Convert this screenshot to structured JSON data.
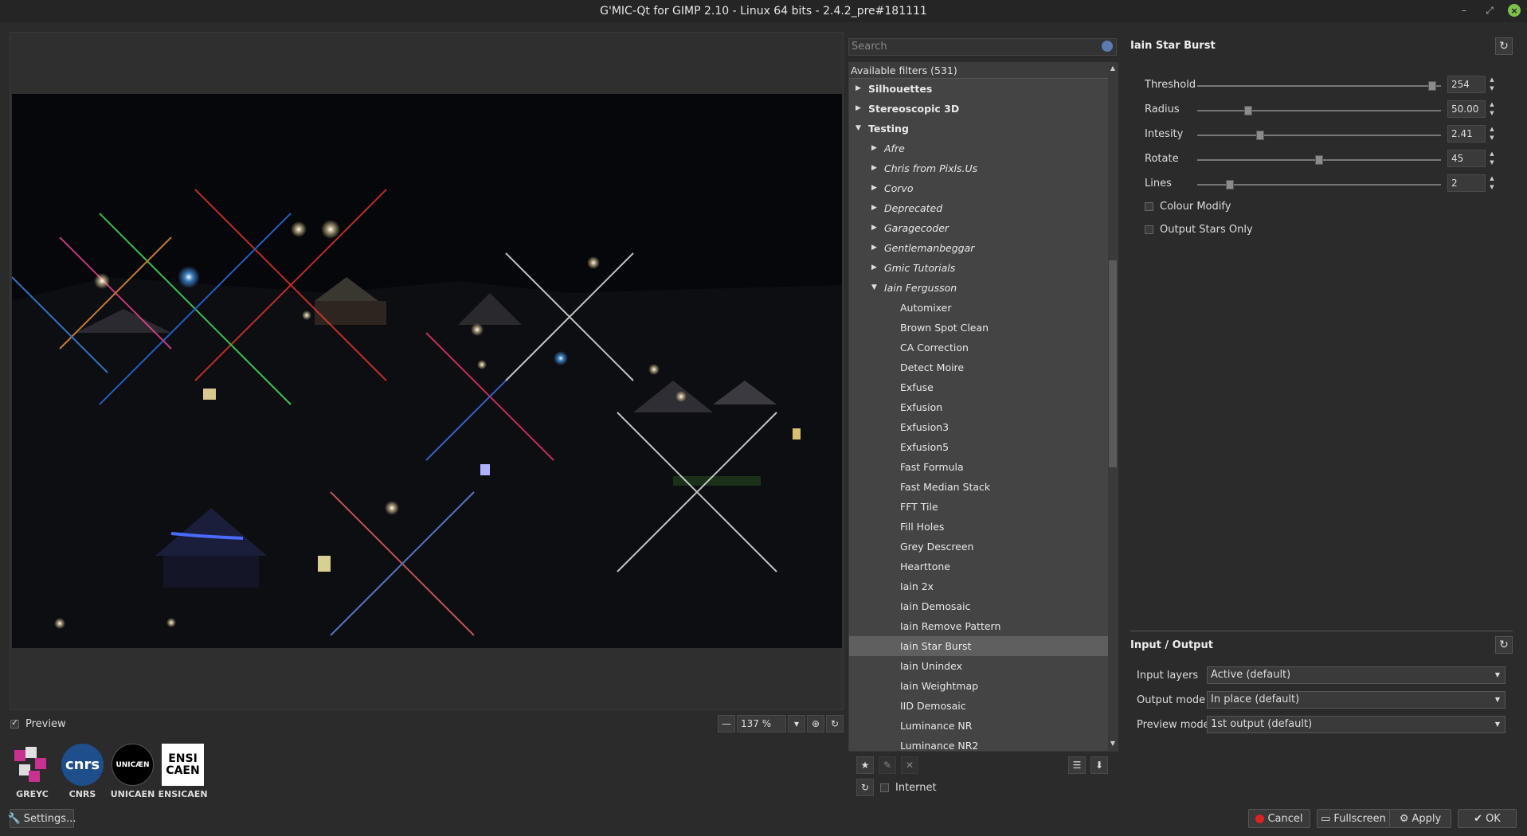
{
  "window": {
    "title": "G'MIC-Qt for GIMP 2.10 - Linux 64 bits - 2.4.2_pre#181111"
  },
  "preview": {
    "label": "Preview",
    "zoom": "137 %"
  },
  "logos": [
    "GREYC",
    "CNRS",
    "UNICAEN",
    "ENSICAEN"
  ],
  "logo_marks": {
    "cnrs": "cnrs",
    "unicaen": "UNICÆN",
    "ensicaen_1": "ENSI",
    "ensicaen_2": "CAEN"
  },
  "buttons": {
    "settings": "Settings...",
    "cancel": "Cancel",
    "fullscreen": "Fullscreen",
    "apply": "Apply",
    "ok": "OK"
  },
  "search": {
    "placeholder": "Search"
  },
  "tree": {
    "header": "Available filters (531)",
    "categories": [
      "Silhouettes",
      "Stereoscopic 3D",
      "Testing"
    ],
    "subcategories": [
      "Afre",
      "Chris from Pixls.Us",
      "Corvo",
      "Deprecated",
      "Garagecoder",
      "Gentlemanbeggar",
      "Gmic Tutorials",
      "Iain Fergusson"
    ],
    "filters": [
      "Automixer",
      "Brown Spot Clean",
      "CA Correction",
      "Detect Moire",
      "Exfuse",
      "Exfusion",
      "Exfusion3",
      "Exfusion5",
      "Fast Formula",
      "Fast Median Stack",
      "FFT Tile",
      "Fill Holes",
      "Grey Descreen",
      "Hearttone",
      "Iain 2x",
      "Iain Demosaic",
      "Iain Remove Pattern",
      "Iain Star Burst",
      "Iain Unindex",
      "Iain Weightmap",
      "IID Demosaic",
      "Luminance NR",
      "Luminance NR2"
    ],
    "selected": "Iain Star Burst"
  },
  "internet": {
    "label": "Internet"
  },
  "filter": {
    "title": "Iain Star Burst",
    "params": [
      {
        "label": "Threshold",
        "value": "254",
        "fraction": 0.98
      },
      {
        "label": "Radius",
        "value": "50.00",
        "fraction": 0.2
      },
      {
        "label": "Intesity",
        "value": "2.41",
        "fraction": 0.25
      },
      {
        "label": "Rotate",
        "value": "45",
        "fraction": 0.5
      },
      {
        "label": "Lines",
        "value": "2",
        "fraction": 0.12
      }
    ],
    "checkboxes": [
      "Colour Modify",
      "Output Stars Only"
    ]
  },
  "io": {
    "title": "Input / Output",
    "rows": [
      {
        "label": "Input layers",
        "value": "Active (default)"
      },
      {
        "label": "Output mode",
        "value": "In place (default)"
      },
      {
        "label": "Preview mode",
        "value": "1st output (default)"
      }
    ]
  },
  "colors": {
    "background": "#2b2b2b",
    "tree": "#444444",
    "selected_row": "#5f5f5f",
    "accent": "#7cc24a"
  }
}
